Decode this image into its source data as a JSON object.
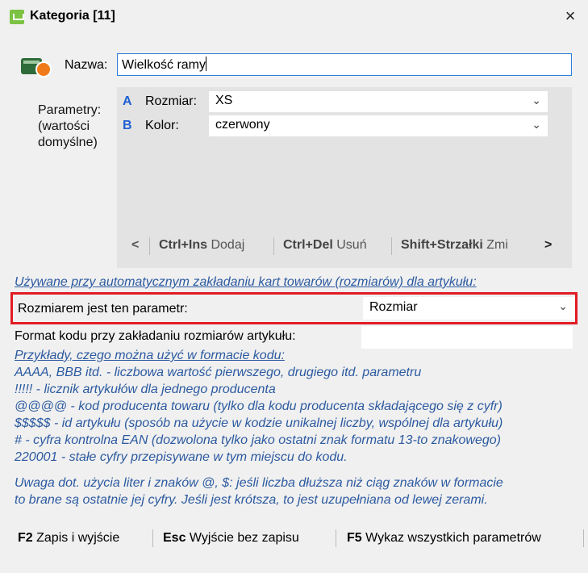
{
  "window": {
    "title": "Kategoria [11]",
    "close_symbol": "×"
  },
  "name": {
    "label": "Nazwa:",
    "value": "Wielkość ramy"
  },
  "params": {
    "label": [
      "Parametry:",
      "(wartości",
      "domyślne)"
    ],
    "rows": [
      {
        "letter": "A",
        "name": "Rozmiar:",
        "value": "XS"
      },
      {
        "letter": "B",
        "name": "Kolor:",
        "value": "czerwony"
      }
    ],
    "toolbar": {
      "prev": "<",
      "add_key": "Ctrl+Ins",
      "add_label": "Dodaj",
      "del_key": "Ctrl+Del",
      "del_label": "Usuń",
      "move_key": "Shift+Strzałki",
      "move_label": "Zmi",
      "next": ">"
    }
  },
  "auto_note": "Używane przy automatycznym zakładaniu kart towarów (rozmiarów) dla artykułu:",
  "size_param": {
    "label": "Rozmiarem jest ten parametr:",
    "value": "Rozmiar"
  },
  "format": {
    "label": "Format kodu przy zakładaniu rozmiarów artykułu:",
    "value": ""
  },
  "examples": {
    "heading": "Przykłady, czego można użyć w formacie kodu:",
    "lines": [
      "AAAA, BBB itd. - liczbowa wartość pierwszego, drugiego itd. parametru",
      "!!!!! - licznik artykułów dla jednego producenta",
      "@@@@ - kod producenta towaru (tylko dla kodu producenta składającego się z cyfr)",
      "$$$$$ - id artykułu (sposób na użycie w kodzie unikalnej liczby, wspólnej dla artykułu)",
      "# - cyfra kontrolna EAN (dozwolona tylko jako ostatni znak formatu 13-to znakowego)",
      "220001 - stałe cyfry przepisywane w tym miejscu do kodu."
    ]
  },
  "warning": [
    "Uwaga dot. użycia liter i znaków @, $: jeśli liczba dłuższa niż ciąg znaków w formacie",
    "to brane są ostatnie jej cyfry. Jeśli jest krótsza, to jest uzupełniana od lewej zerami."
  ],
  "footer": {
    "save_key": "F2",
    "save_label": "Zapis i wyjście",
    "esc_key": "Esc",
    "esc_label": "Wyjście bez zapisu",
    "list_key": "F5",
    "list_label": "Wykaz wszystkich parametrów"
  },
  "colors": {
    "accent": "#1f5fd2",
    "info_text": "#2c5aa0",
    "highlight_border": "#e21b23",
    "focus_border": "#2f7fd6"
  },
  "icons": [
    "cart-icon",
    "category-card-icon",
    "close-icon",
    "chevron-down-icon",
    "chevron-left-icon",
    "chevron-right-icon"
  ]
}
